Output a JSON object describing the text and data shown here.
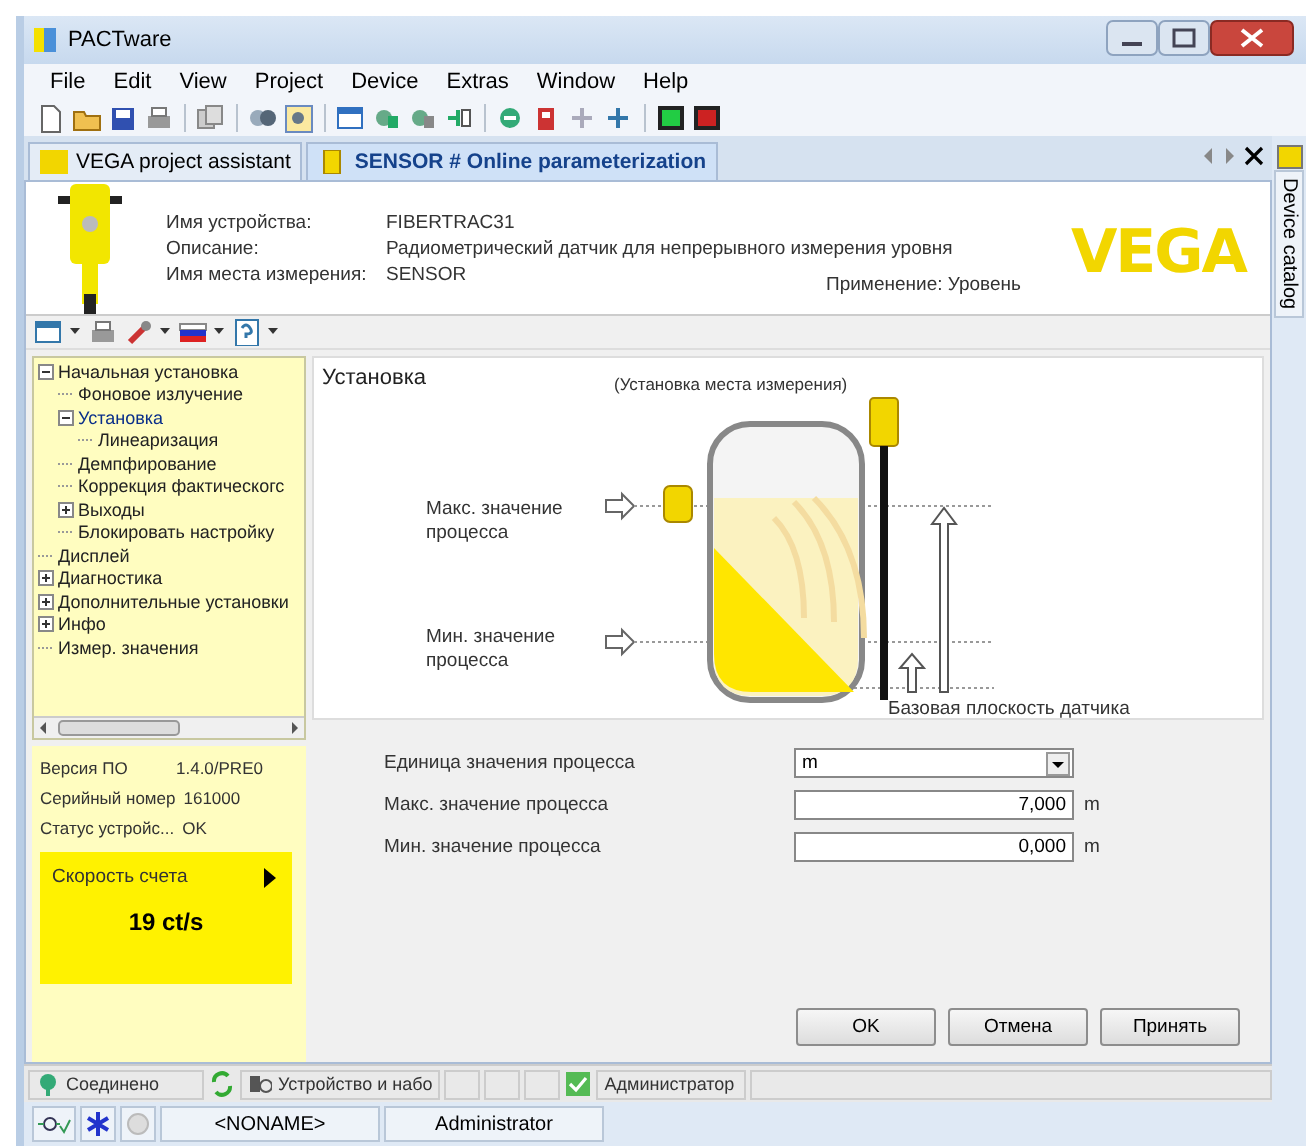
{
  "window": {
    "title": "PACTware"
  },
  "menu": [
    "File",
    "Edit",
    "View",
    "Project",
    "Device",
    "Extras",
    "Window",
    "Help"
  ],
  "tabs": [
    {
      "label": "VEGA project assistant",
      "selected": false
    },
    {
      "label": "SENSOR # Online parameterization",
      "selected": true
    }
  ],
  "side_panel": {
    "label": "Device catalog"
  },
  "device_header": {
    "fields": [
      {
        "label": "Имя устройства:",
        "value": "FIBERTRAC31"
      },
      {
        "label": "Описание:",
        "value": "Радиометрический датчик для непрерывного измерения уровня"
      },
      {
        "label": "Имя места измерения:",
        "value": "SENSOR"
      }
    ],
    "application": "Применение: Уровень",
    "logo": "VEGA"
  },
  "tree": [
    {
      "label": "Начальная установка",
      "expanded": true,
      "selected": false,
      "children": [
        {
          "label": "Фоновое излучение",
          "selected": false
        },
        {
          "label": "Установка",
          "expanded": true,
          "selected": true,
          "children": [
            {
              "label": "Линеаризация",
              "selected": false
            }
          ]
        },
        {
          "label": "Демпфирование",
          "selected": false
        },
        {
          "label": "Коррекция фактическогс",
          "selected": false
        },
        {
          "label": "Выходы",
          "expanded": false,
          "selected": false
        },
        {
          "label": "Блокировать настройку",
          "selected": false
        }
      ]
    },
    {
      "label": "Дисплей",
      "selected": false
    },
    {
      "label": "Диагностика",
      "expanded": false,
      "selected": false
    },
    {
      "label": "Дополнительные установки",
      "expanded": false,
      "selected": false
    },
    {
      "label": "Инфо",
      "expanded": false,
      "selected": false
    },
    {
      "label": "Измер. значения",
      "selected": false
    }
  ],
  "device_info": [
    {
      "label": "Версия ПО",
      "value": "1.4.0/PRE0"
    },
    {
      "label": "Серийный номер",
      "value": "161000"
    },
    {
      "label": "Статус устройс...",
      "value": "OK"
    }
  ],
  "count_rate": {
    "label": "Скорость счета",
    "value": "19 ct/s"
  },
  "diagram": {
    "title": "Установка",
    "subtitle": "(Установка места измерения)",
    "max_label": [
      "Макс. значение",
      "процесса"
    ],
    "min_label": [
      "Мин. значение",
      "процесса"
    ],
    "base_label": "Базовая плоскость датчика"
  },
  "form": [
    {
      "kind": "select",
      "label": "Единица значения процесса",
      "value": "m"
    },
    {
      "kind": "input",
      "label": "Макс. значение процесса",
      "value": "7,000",
      "unit": "m"
    },
    {
      "kind": "input",
      "label": "Мин. значение процесса",
      "value": "0,000",
      "unit": "m"
    }
  ],
  "buttons": [
    "OK",
    "Отмена",
    "Принять"
  ],
  "status_bar": {
    "connection": "Соединено",
    "device_set": "Устройство и набо",
    "user_role": "Администратор"
  },
  "bottom_bar": {
    "project": "<NONAME>",
    "user": "Administrator"
  }
}
